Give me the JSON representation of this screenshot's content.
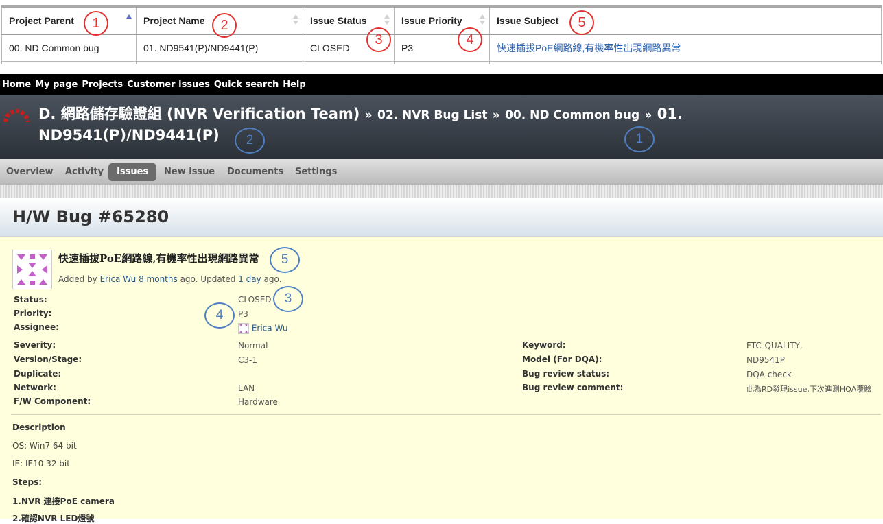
{
  "table": {
    "headers": [
      "Project Parent",
      "Project Name",
      "Issue Status",
      "Issue Priority",
      "Issue Subject"
    ],
    "row": [
      "00. ND Common bug",
      "01. ND9541(P)/ND9441(P)",
      "CLOSED",
      "P3",
      "快速插拔PoE網路線,有機率性出現網路異常"
    ]
  },
  "callouts": {
    "c1": "1",
    "c2": "2",
    "c3": "3",
    "c4": "4",
    "c5": "5"
  },
  "topmenu": [
    "Home",
    "My page",
    "Projects",
    "Customer issues",
    "Quick search",
    "Help"
  ],
  "header": {
    "project_root": "D. 網路儲存驗證組 (NVR Verification Team)",
    "sep": "»",
    "crumb1": "02. NVR Bug List",
    "crumb2": "00. ND Common bug",
    "current": "01. ND9541(P)/ND9441(P)"
  },
  "tabs": [
    "Overview",
    "Activity",
    "Issues",
    "New issue",
    "Documents",
    "Settings"
  ],
  "issue": {
    "title": "H/W Bug #65280",
    "subject": "快速插拔PoE網路線,有機率性出現網路異常",
    "added_by": "Added by",
    "author": "Erica Wu",
    "age": "8 months",
    "ago_updated": "ago. Updated",
    "updated": "1 day",
    "ago": "ago.",
    "left_attrs": [
      {
        "k": "Status:",
        "v": "CLOSED"
      },
      {
        "k": "Priority:",
        "v": "P3"
      },
      {
        "k": "Assignee:",
        "v": "Erica Wu"
      },
      {
        "k": "Severity:",
        "v": "Normal"
      },
      {
        "k": "Version/Stage:",
        "v": "C3-1"
      },
      {
        "k": "Duplicate:",
        "v": ""
      },
      {
        "k": "Network:",
        "v": "LAN"
      },
      {
        "k": "F/W Component:",
        "v": "Hardware"
      }
    ],
    "right_attrs": [
      {
        "k": "Keyword:",
        "v": "FTC-QUALITY,"
      },
      {
        "k": "Model (For DQA):",
        "v": "ND9541P"
      },
      {
        "k": "Bug review status:",
        "v": "DQA check"
      },
      {
        "k": "Bug review comment:",
        "v": "此為RD發現issue,下次進測HQA覆驗"
      }
    ],
    "description_label": "Description",
    "os": "OS: Win7 64 bit",
    "ie": "IE: IE10 32 bit",
    "steps_label": "Steps:",
    "step1": "1.NVR 連接PoE camera",
    "step2": "2.確認NVR LED燈號"
  },
  "colors": {
    "accent_red": "#e53030",
    "accent_blue": "#4f7fc2",
    "link": "#2a5a8a",
    "issue_bg": "#ffffdd"
  }
}
